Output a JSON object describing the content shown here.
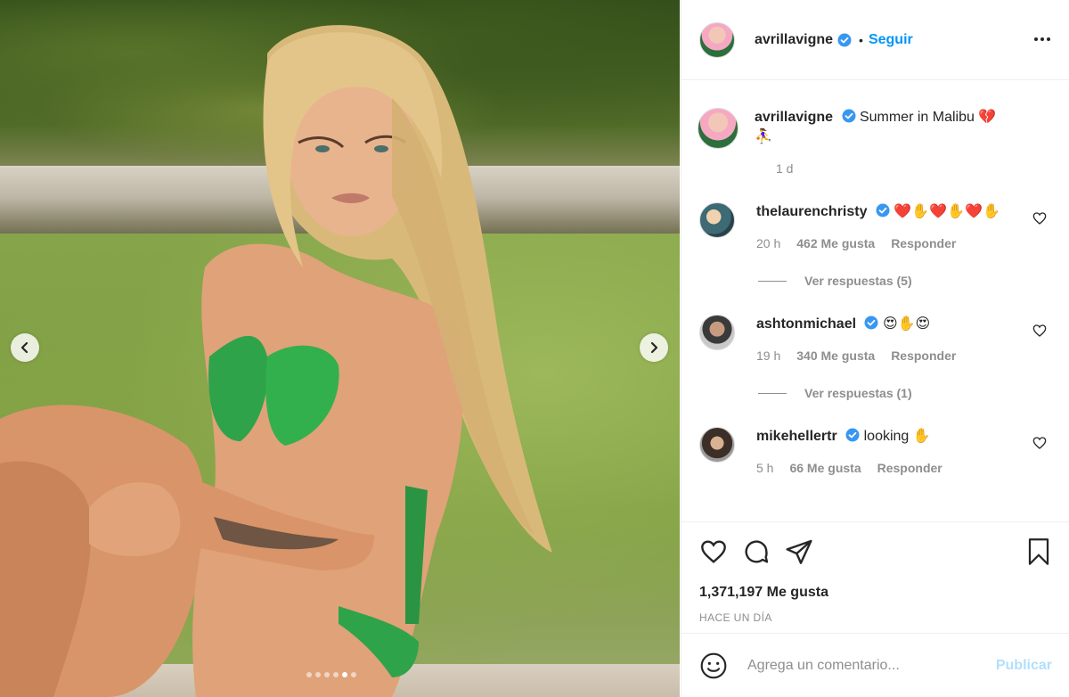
{
  "post": {
    "username": "avrillavigne",
    "follow_label": "Seguir",
    "bullet": "•",
    "caption_text": "Summer in Malibu 💔",
    "caption_extra": "⛹️‍♀️",
    "caption_time": "1 d"
  },
  "comments": [
    {
      "user": "thelaurenchristy",
      "text": "❤️✋❤️✋❤️✋",
      "time": "20 h",
      "likes": "462 Me gusta",
      "reply": "Responder",
      "view_replies": "Ver respuestas (5)"
    },
    {
      "user": "ashtonmichael",
      "text": "😍✋😍",
      "time": "19 h",
      "likes": "340 Me gusta",
      "reply": "Responder",
      "view_replies": "Ver respuestas (1)"
    },
    {
      "user": "mikehellertr",
      "text": "looking ✋",
      "time": "5 h",
      "likes": "66 Me gusta",
      "reply": "Responder"
    }
  ],
  "stats": {
    "likes": "1,371,197 Me gusta",
    "posted": "HACE UN DÍA"
  },
  "composer": {
    "placeholder": "Agrega un comentario...",
    "publish_label": "Publicar"
  },
  "carousel": {
    "total": 6,
    "current": 5
  },
  "colors": {
    "accent": "#0095f6",
    "publish_disabled": "#b2dffc",
    "verified": "#3897f0"
  }
}
